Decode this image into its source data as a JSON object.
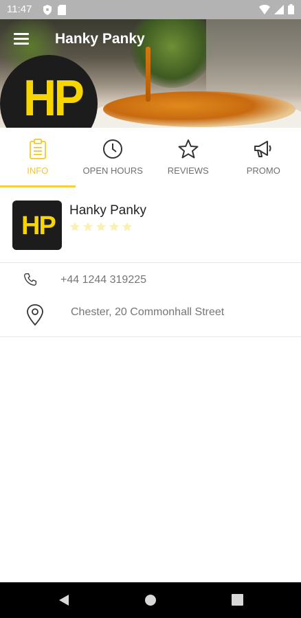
{
  "status_bar": {
    "time": "11:47",
    "icons_left": [
      "shield-icon",
      "sim-card-icon"
    ],
    "icons_right": [
      "wifi-icon",
      "cell-signal-icon",
      "battery-icon"
    ]
  },
  "header": {
    "title": "Hanky Panky",
    "logo_text": "HP"
  },
  "tabs": [
    {
      "label": "INFO",
      "icon": "clipboard-icon",
      "active": true
    },
    {
      "label": "OPEN HOURS",
      "icon": "clock-icon",
      "active": false
    },
    {
      "label": "REVIEWS",
      "icon": "star-icon",
      "active": false
    },
    {
      "label": "PROMO",
      "icon": "megaphone-icon",
      "active": false
    }
  ],
  "business": {
    "name": "Hanky Panky",
    "logo_text": "HP",
    "rating": 0,
    "rating_max": 5
  },
  "contact": {
    "phone": "+44 1244 319225",
    "address": "Chester, 20 Commonhall Street"
  },
  "colors": {
    "accent": "#f3cf3d",
    "logo_yellow": "#f7d500",
    "logo_bg": "#1c1c1c",
    "status_bar": "#b3b3b3",
    "nav_bar": "#000000"
  },
  "nav_bar": [
    "back-icon",
    "home-icon",
    "recents-icon"
  ]
}
